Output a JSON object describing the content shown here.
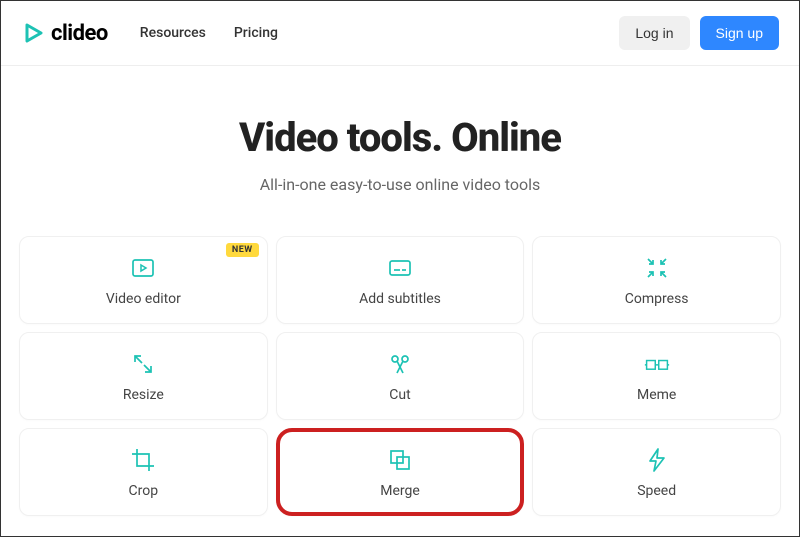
{
  "header": {
    "brand": "clideo",
    "nav": [
      {
        "label": "Resources"
      },
      {
        "label": "Pricing"
      }
    ],
    "login_label": "Log in",
    "signup_label": "Sign up"
  },
  "hero": {
    "title": "Video tools. Online",
    "subtitle": "All-in-one easy-to-use online video tools"
  },
  "tools": [
    {
      "label": "Video editor",
      "icon": "play-frame-icon",
      "badge": "NEW"
    },
    {
      "label": "Add subtitles",
      "icon": "subtitles-icon"
    },
    {
      "label": "Compress",
      "icon": "compress-icon"
    },
    {
      "label": "Resize",
      "icon": "resize-icon"
    },
    {
      "label": "Cut",
      "icon": "scissors-icon"
    },
    {
      "label": "Meme",
      "icon": "meme-icon"
    },
    {
      "label": "Crop",
      "icon": "crop-icon"
    },
    {
      "label": "Merge",
      "icon": "merge-icon",
      "highlighted": true
    },
    {
      "label": "Speed",
      "icon": "lightning-icon"
    }
  ],
  "colors": {
    "accent": "#1dc2b4",
    "primary_button": "#2e87ff",
    "highlight_border": "#cc2020",
    "badge": "#ffd93d"
  }
}
